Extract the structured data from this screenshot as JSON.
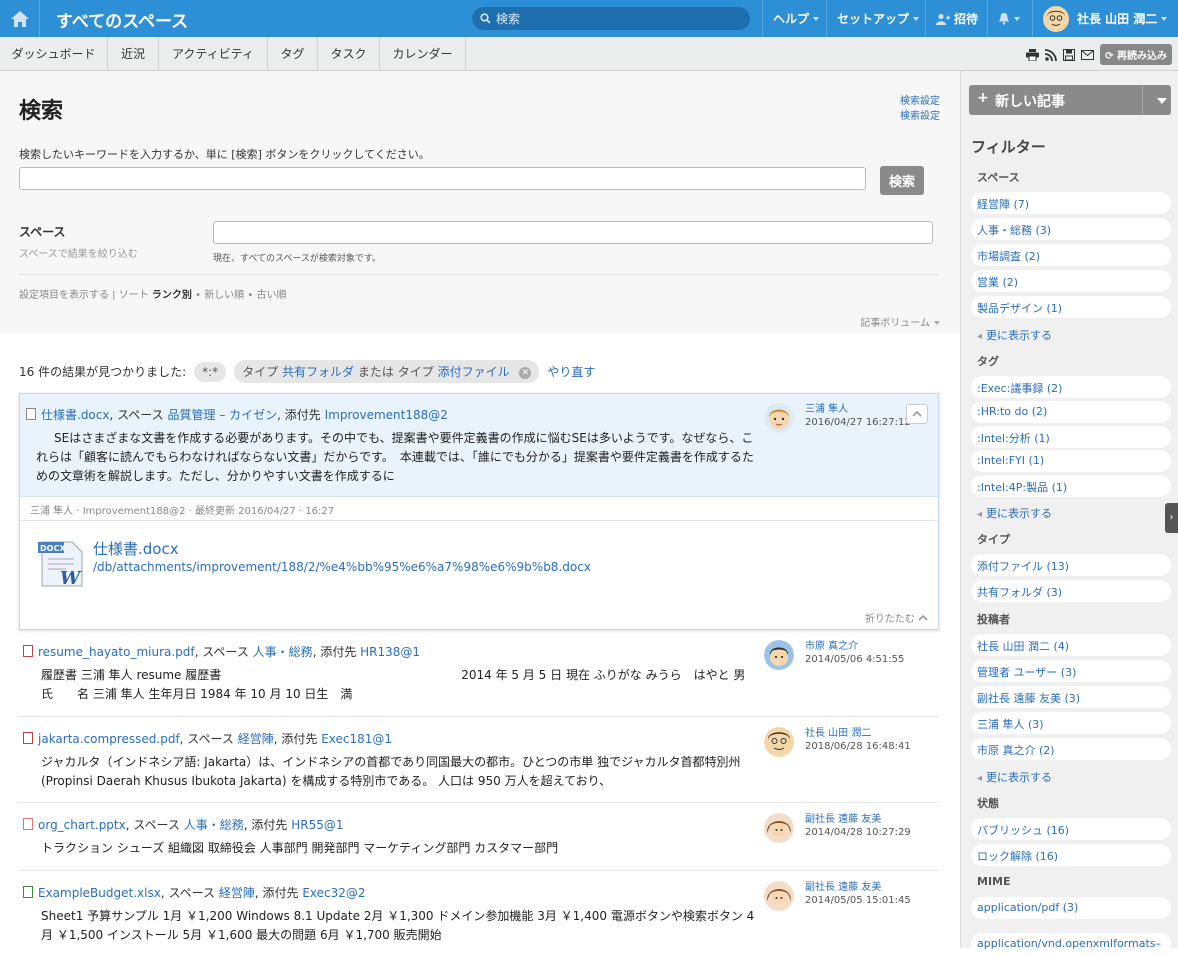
{
  "topbar": {
    "title": "すべてのスペース",
    "search_placeholder": "検索",
    "help": "ヘルプ",
    "setup": "セットアップ",
    "invite": "招待",
    "user": "社長 山田 潤二"
  },
  "tabs": [
    "ダッシュボード",
    "近況",
    "アクティビティ",
    "タグ",
    "タスク",
    "カレンダー"
  ],
  "reload": "再読み込み",
  "page": {
    "title": "検索",
    "settings1": "検索設定",
    "settings2": "検索設定",
    "instruction": "検索したいキーワードを入力するか、単に [検索] ボタンをクリックしてください。",
    "search_button": "検索",
    "space_label": "スペース",
    "space_sub": "スペースで結果を絞り込む",
    "space_note": "現在、すべてのスペースが検索対象です。",
    "sort_prefix": "設定項目を表示する | ソート",
    "sort_rank": "ランク別",
    "sort_new": "新しい順",
    "sort_old": "古い順",
    "volume": "記事ボリューム",
    "results": "16 件の結果が見つかりました:",
    "chip1": "*:*",
    "chip2_a": "タイプ",
    "chip2_b": "共有フォルダ",
    "chip2_c": "または",
    "chip2_d": "タイプ",
    "chip2_e": "添付ファイル",
    "redo": "やり直す"
  },
  "card1": {
    "file": "仕様書.docx",
    "sep1": ", スペース",
    "space": "品質管理 – カイゼン",
    "sep2": ", 添付先",
    "target": "Improvement188@2",
    "author": "三浦 隼人",
    "date": "2016/04/27 16:27:12",
    "snippet": "SEはさまざまな文書を作成する必要があります。その中でも、提案書や要件定義書の作成に悩むSEは多いようです。なぜなら、これらは「顧客に読んでもらわなければならない文書」だからです。　本連載では、「誰にでも分かる」提案書や要件定義書を作成するための文章術を解説します。ただし、分かりやすい文書を作成するに",
    "meta": "三浦 隼人 · Improvement188@2 · 最終更新 2016/04/27 · 16:27",
    "doc_badge": "DOCX",
    "att_name": "仕様書.docx",
    "att_path": "/db/attachments/improvement/188/2/%e4%bb%95%e6%a7%98%e6%9b%b8.docx",
    "collapse": "折りたたむ"
  },
  "items": [
    {
      "file": "resume_hayato_miura.pdf",
      "sep1": ", スペース",
      "space": "人事・総務",
      "sep2": ", 添付先",
      "target": "HR138@1",
      "author": "市原 真之介",
      "date": "2014/05/06 4:51:55",
      "line1": "履歴書 三浦 隼人 resume 履歴書　　　　　　　　　　　　　　　　　　　　2014 年 5 月 5 日 現在 ふりがな みうら　はやと 男",
      "line2": "氏　　名 三浦 隼人 生年月日 1984 年 10 月 10 日生　満"
    },
    {
      "file": "jakarta.compressed.pdf",
      "sep1": ", スペース",
      "space": "経営陣",
      "sep2": ", 添付先",
      "target": "Exec181@1",
      "author": "社長 山田 潤二",
      "date": "2018/06/28 16:48:41",
      "line1": "ジャカルタ（インドネシア語: Jakarta）は、インドネシアの首都であり同国最大の都市。ひとつの市単 独でジャカルタ首都特別州",
      "line2": "(Propinsi Daerah Khusus Ibukota Jakarta) を構成する特別市である。 人口は 950 万人を超えており、"
    },
    {
      "file": "org_chart.pptx",
      "sep1": ", スペース",
      "space": "人事・総務",
      "sep2": ", 添付先",
      "target": "HR55@1",
      "author": "副社長 遠藤 友美",
      "date": "2014/04/28 10:27:29",
      "line1": "トラクション シューズ 組織図 取締役会 人事部門 開発部門 マーケティング部門 カスタマー部門",
      "line2": ""
    },
    {
      "file": "ExampleBudget.xlsx",
      "sep1": ", スペース",
      "space": "経営陣",
      "sep2": ", 添付先",
      "target": "Exec32@2",
      "author": "副社長 遠藤 友美",
      "date": "2014/05/05 15:01:45",
      "line1": "Sheet1 予算サンプル 1月 ￥1,200 Windows 8.1 Update 2月 ￥1,300 ドメイン参加機能 3月 ￥1,400 電源ボタンや検索ボタン 4",
      "line2": "月 ￥1,500 インストール 5月 ￥1,600 最大の問題 6月 ￥1,700 販売開始"
    }
  ],
  "sidebar": {
    "new_post": "新しい記事",
    "filter": "フィルター",
    "spaces_h": "スペース",
    "spaces": [
      "経営陣 (7)",
      "人事・総務 (3)",
      "市場調査 (2)",
      "営業 (2)",
      "製品デザイン (1)"
    ],
    "more": "更に表示する",
    "tags_h": "タグ",
    "tags": [
      ":Exec:議事録 (2)",
      ":HR:to do (2)",
      ":Intel:分析 (1)",
      ":Intel:FYI (1)",
      ":Intel:4P:製品 (1)"
    ],
    "type_h": "タイプ",
    "types": [
      "添付ファイル (13)",
      "共有フォルダ (3)"
    ],
    "poster_h": "投稿者",
    "posters": [
      "社長 山田 潤二 (4)",
      "管理者 ユーザー (3)",
      "副社長 遠藤 友美 (3)",
      "三浦 隼人 (3)",
      "市原 真之介 (2)"
    ],
    "state_h": "状態",
    "states": [
      "パブリッシュ (16)",
      "ロック解除 (16)"
    ],
    "mime_h": "MIME",
    "mimes": [
      "application/pdf (3)",
      "application/vnd.openxmlformats–"
    ]
  }
}
